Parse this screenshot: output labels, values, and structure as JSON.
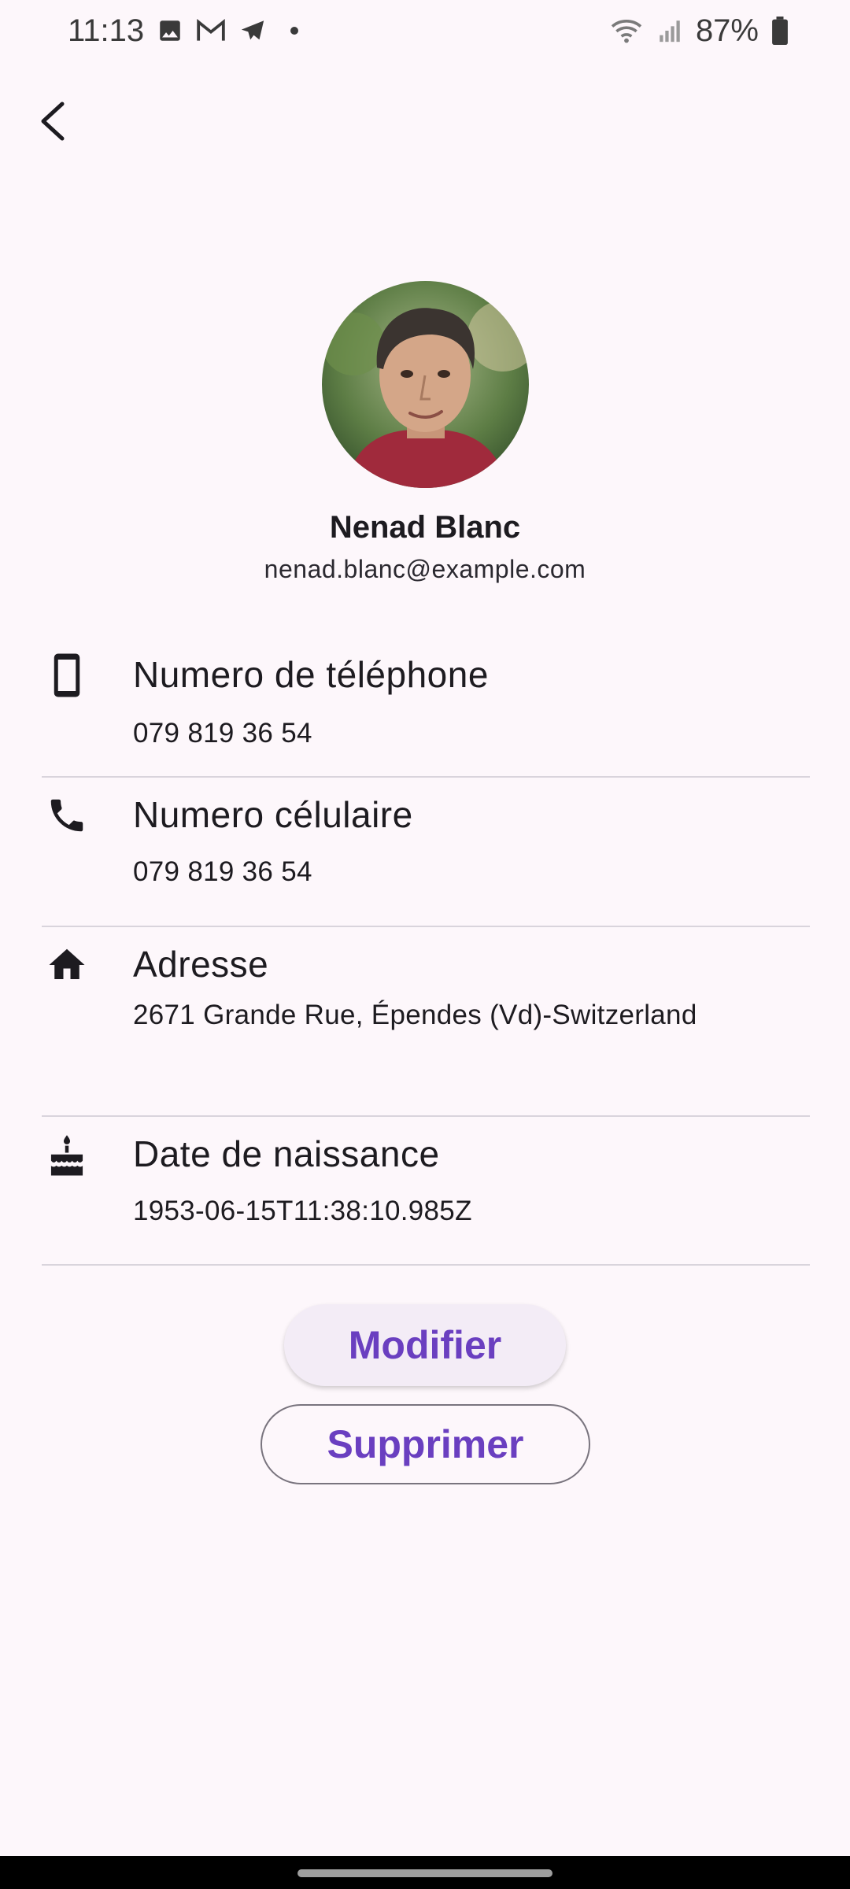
{
  "status_bar": {
    "time": "11:13",
    "battery": "87%",
    "icons": [
      "image-icon",
      "gmail-icon",
      "telegram-icon",
      "notification-dot",
      "wifi-icon",
      "signal-icon",
      "battery-icon"
    ]
  },
  "app_bar": {
    "back_icon": "arrow-back-icon"
  },
  "profile": {
    "name": "Nenad Blanc",
    "email": "nenad.blanc@example.com"
  },
  "details": [
    {
      "icon": "smartphone-icon",
      "title": "Numero de téléphone",
      "value": "079 819 36 54"
    },
    {
      "icon": "phone-icon",
      "title": "Numero célulaire",
      "value": "079 819 36 54"
    },
    {
      "icon": "home-icon",
      "title": "Adresse",
      "value": "2671 Grande Rue, Épendes (Vd)-Switzerland"
    },
    {
      "icon": "cake-icon",
      "title": "Date de naissance",
      "value": "1953-06-15T11:38:10.985Z"
    }
  ],
  "actions": {
    "modify_label": "Modifier",
    "delete_label": "Supprimer"
  },
  "colors": {
    "background": "#fdf7fb",
    "accent": "#6a3fc0",
    "divider": "#d9d4dc"
  }
}
